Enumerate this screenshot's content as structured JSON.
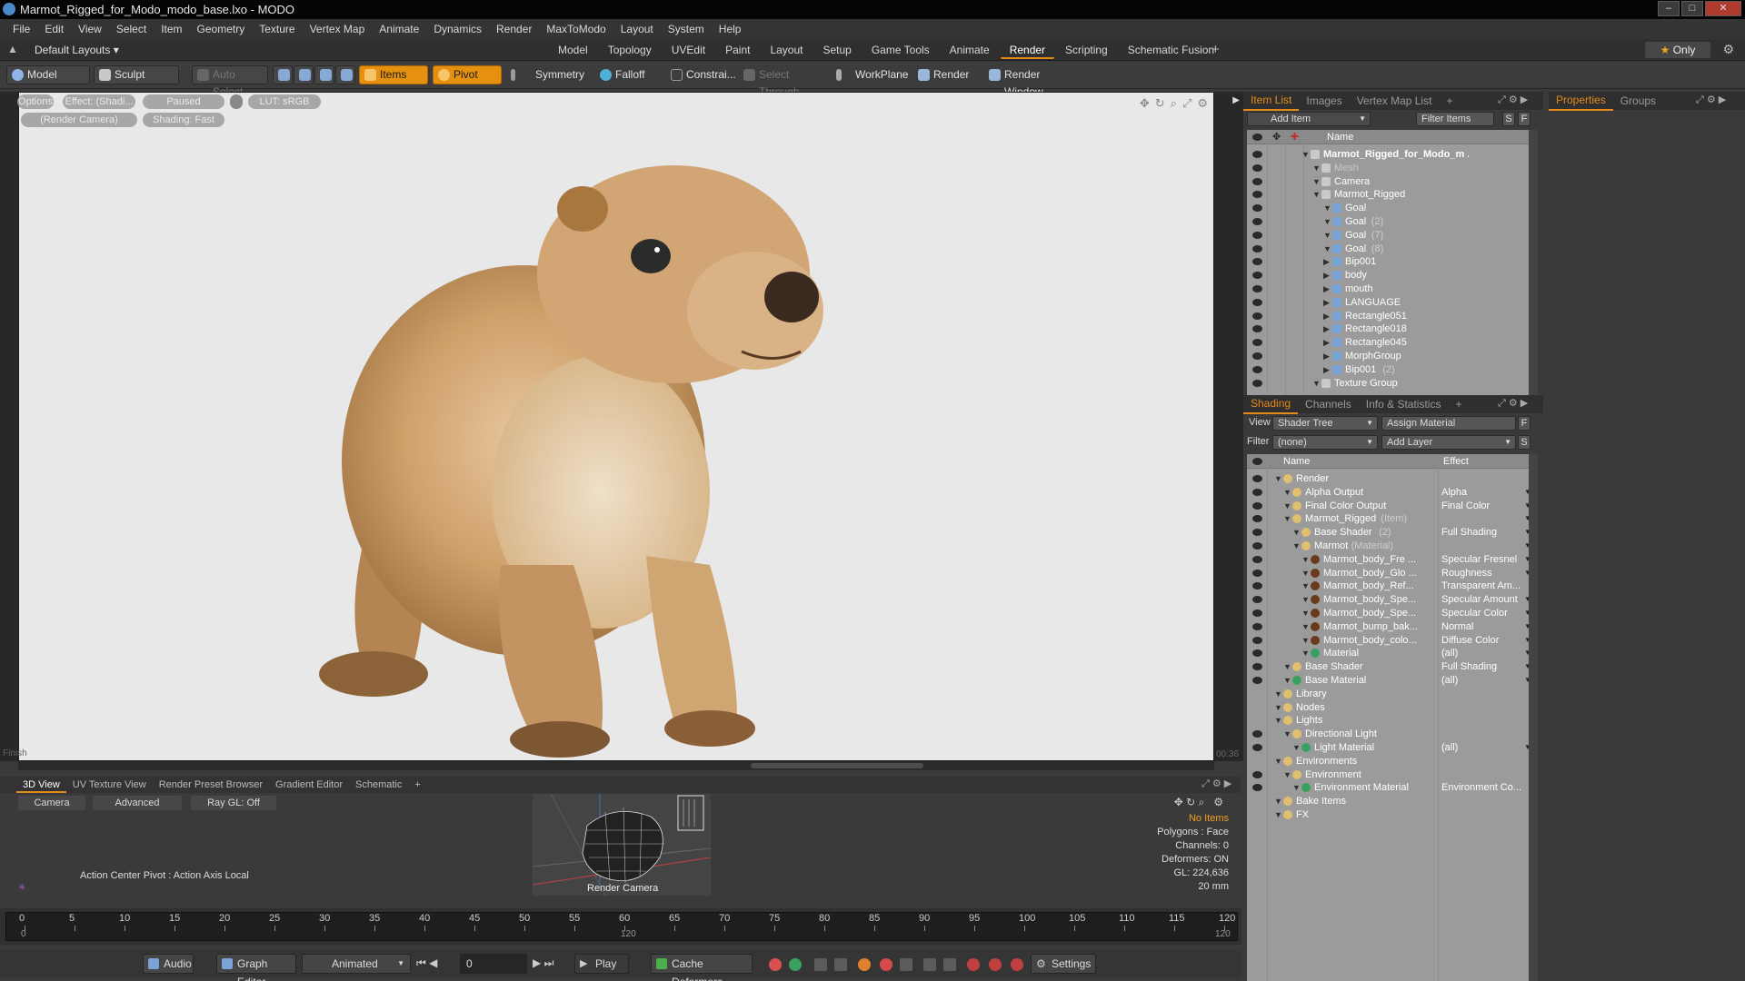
{
  "window": {
    "title": "Marmot_Rigged_for_Modo_modo_base.lxo - MODO"
  },
  "menu": [
    "File",
    "Edit",
    "View",
    "Select",
    "Item",
    "Geometry",
    "Texture",
    "Vertex Map",
    "Animate",
    "Dynamics",
    "Render",
    "MaxToModo",
    "Layout",
    "System",
    "Help"
  ],
  "layouts": {
    "label": "Default Layouts ▾"
  },
  "mode_tabs": [
    "Model",
    "Topology",
    "UVEdit",
    "Paint",
    "Layout",
    "Setup",
    "Game Tools",
    "Animate",
    "Render",
    "Scripting",
    "Schematic Fusion"
  ],
  "active_mode": "Render",
  "only_label": "Only",
  "toolbar": {
    "model": "Model",
    "sculpt": "Sculpt",
    "auto_select": "Auto Select",
    "items": "Items",
    "pivot": "Pivot",
    "symmetry": "Symmetry",
    "falloff": "Falloff",
    "constrain": "Constrai...",
    "select_through": "Select Through",
    "workplane": "WorkPlane",
    "render": "Render",
    "render_window": "Render Window"
  },
  "viewport": {
    "pills": {
      "options": "Options",
      "effect": "Effect: (Shadi...",
      "paused": "Paused",
      "lut": "LUT: sRGB",
      "camera": "(Render Camera)",
      "shading": "Shading: Fast"
    },
    "finish": "Finish",
    "time": "00:36"
  },
  "bottom_tabs": [
    "3D View",
    "UV Texture View",
    "Render Preset Browser",
    "Gradient Editor",
    "Schematic"
  ],
  "mini": {
    "camera": "Camera",
    "advanced": "Advanced",
    "raygl": "Ray GL: Off",
    "action_center": "Action Center Pivot : Action Axis Local",
    "render_camera": "Render Camera",
    "stats": {
      "no_items": "No Items",
      "polygons": "Polygons : Face",
      "channels": "Channels: 0",
      "deformers": "Deformers: ON",
      "gl": "GL: 224,636",
      "mm": "20 mm"
    }
  },
  "ruler": {
    "ticks": [
      "0",
      "5",
      "10",
      "15",
      "20",
      "25",
      "30",
      "35",
      "40",
      "45",
      "50",
      "55",
      "60",
      "65",
      "70",
      "75",
      "80",
      "85",
      "90",
      "95",
      "100",
      "105",
      "110",
      "115",
      "120"
    ],
    "sub_left": "0",
    "sub_mid": "120",
    "sub_right": "120"
  },
  "transport": {
    "audio": "Audio",
    "graph_editor": "Graph Editor",
    "animated": "Animated",
    "frame": "0",
    "play": "Play",
    "cache": "Cache Deformers",
    "settings": "Settings"
  },
  "item_panel": {
    "tabs": [
      "Item List",
      "Images",
      "Vertex Map List"
    ],
    "right_tabs": [
      "Properties",
      "Groups"
    ],
    "add_item": "Add Item",
    "filter_items": "Filter Items",
    "s": "S",
    "f": "F",
    "col_name": "Name",
    "items": [
      {
        "label": "Marmot_Rigged_for_Modo_m ...",
        "sub": "",
        "indent": 0,
        "bold": true
      },
      {
        "label": "Mesh",
        "sub": "",
        "indent": 1,
        "dim": true
      },
      {
        "label": "Camera",
        "sub": "",
        "indent": 1
      },
      {
        "label": "Marmot_Rigged",
        "sub": "",
        "indent": 1
      },
      {
        "label": "Goal",
        "sub": "",
        "indent": 2
      },
      {
        "label": "Goal",
        "sub": "(2)",
        "indent": 2
      },
      {
        "label": "Goal",
        "sub": "(7)",
        "indent": 2
      },
      {
        "label": "Goal",
        "sub": "(8)",
        "indent": 2
      },
      {
        "label": "Bip001",
        "sub": "",
        "indent": 2
      },
      {
        "label": "body",
        "sub": "",
        "indent": 2
      },
      {
        "label": "mouth",
        "sub": "",
        "indent": 2
      },
      {
        "label": "LANGUAGE",
        "sub": "",
        "indent": 2
      },
      {
        "label": "Rectangle051",
        "sub": "",
        "indent": 2
      },
      {
        "label": "Rectangle018",
        "sub": "",
        "indent": 2
      },
      {
        "label": "Rectangle045",
        "sub": "",
        "indent": 2
      },
      {
        "label": "MorphGroup",
        "sub": "",
        "indent": 2
      },
      {
        "label": "Bip001",
        "sub": "(2)",
        "indent": 2
      },
      {
        "label": "Texture Group",
        "sub": "",
        "indent": 1
      }
    ]
  },
  "shading_panel": {
    "tabs": [
      "Shading",
      "Channels",
      "Info & Statistics"
    ],
    "view_label": "View",
    "view_value": "Shader Tree",
    "assign": "Assign Material",
    "f": "F",
    "filter_label": "Filter",
    "filter_value": "(none)",
    "add_layer": "Add Layer",
    "s": "S",
    "col_name": "Name",
    "col_effect": "Effect",
    "rows": [
      {
        "label": "Render",
        "sub": "",
        "effect": "",
        "indent": 0,
        "dd": false
      },
      {
        "label": "Alpha Output",
        "sub": "",
        "effect": "Alpha",
        "indent": 1,
        "dd": true
      },
      {
        "label": "Final Color Output",
        "sub": "",
        "effect": "Final Color",
        "indent": 1,
        "dd": true
      },
      {
        "label": "Marmot_Rigged",
        "sub": "(Item)",
        "effect": "",
        "indent": 1,
        "dd": true
      },
      {
        "label": "Base Shader",
        "sub": "(2)",
        "effect": "Full Shading",
        "indent": 2,
        "dd": true
      },
      {
        "label": "Marmot",
        "sub": "(Material)",
        "effect": "",
        "indent": 2,
        "dd": true
      },
      {
        "label": "Marmot_body_Fre ...",
        "sub": "",
        "effect": "Specular Fresnel",
        "indent": 3,
        "dd": true
      },
      {
        "label": "Marmot_body_Glo ...",
        "sub": "",
        "effect": "Roughness",
        "indent": 3,
        "dd": true
      },
      {
        "label": "Marmot_body_Ref...",
        "sub": "",
        "effect": "Transparent Am...",
        "indent": 3,
        "dd": false
      },
      {
        "label": "Marmot_body_Spe...",
        "sub": "",
        "effect": "Specular Amount",
        "indent": 3,
        "dd": true
      },
      {
        "label": "Marmot_body_Spe...",
        "sub": "",
        "effect": "Specular Color",
        "indent": 3,
        "dd": true
      },
      {
        "label": "Marmot_bump_bak...",
        "sub": "",
        "effect": "Normal",
        "indent": 3,
        "dd": true
      },
      {
        "label": "Marmot_body_colo...",
        "sub": "",
        "effect": "Diffuse Color",
        "indent": 3,
        "dd": true
      },
      {
        "label": "Material",
        "sub": "",
        "effect": "(all)",
        "indent": 3,
        "dd": true
      },
      {
        "label": "Base Shader",
        "sub": "",
        "effect": "Full Shading",
        "indent": 1,
        "dd": true
      },
      {
        "label": "Base Material",
        "sub": "",
        "effect": "(all)",
        "indent": 1,
        "dd": true
      },
      {
        "label": "Library",
        "sub": "",
        "effect": "",
        "indent": 0,
        "dd": false
      },
      {
        "label": "Nodes",
        "sub": "",
        "effect": "",
        "indent": 0,
        "dd": false
      },
      {
        "label": "Lights",
        "sub": "",
        "effect": "",
        "indent": 0,
        "dd": false
      },
      {
        "label": "Directional Light",
        "sub": "",
        "effect": "",
        "indent": 1,
        "dd": false
      },
      {
        "label": "Light Material",
        "sub": "",
        "effect": "(all)",
        "indent": 2,
        "dd": true
      },
      {
        "label": "Environments",
        "sub": "",
        "effect": "",
        "indent": 0,
        "dd": false
      },
      {
        "label": "Environment",
        "sub": "",
        "effect": "",
        "indent": 1,
        "dd": false
      },
      {
        "label": "Environment Material",
        "sub": "",
        "effect": "Environment Co...",
        "indent": 2,
        "dd": false
      },
      {
        "label": "Bake Items",
        "sub": "",
        "effect": "",
        "indent": 0,
        "dd": false
      },
      {
        "label": "FX",
        "sub": "",
        "effect": "",
        "indent": 0,
        "dd": false
      }
    ]
  }
}
